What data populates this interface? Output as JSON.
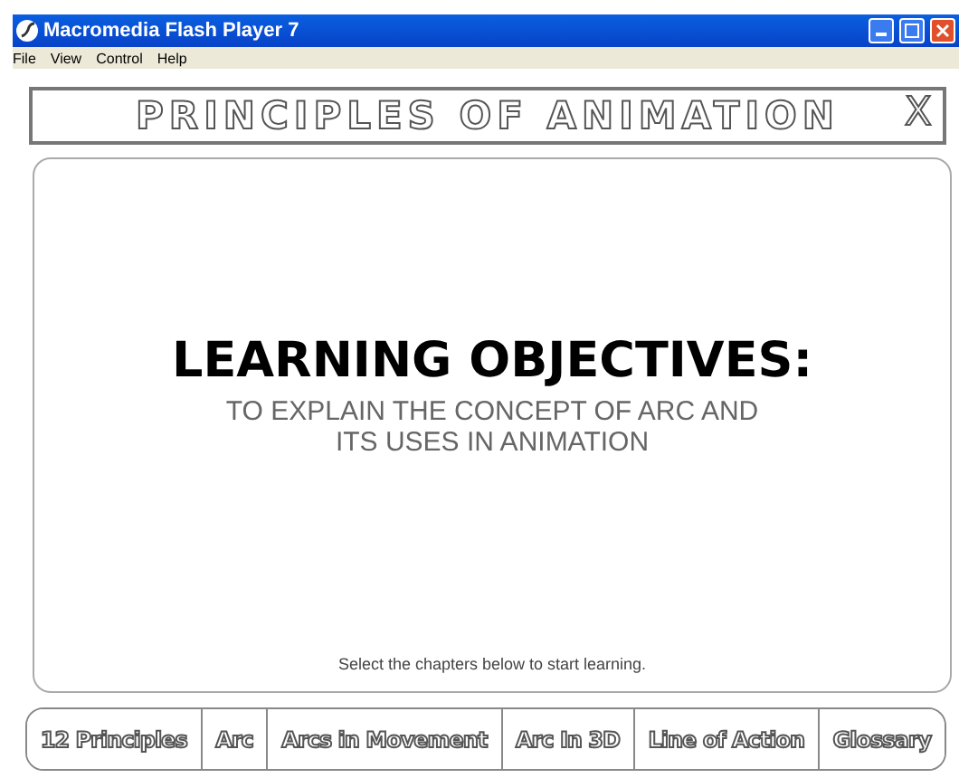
{
  "window": {
    "title": "Macromedia Flash Player 7"
  },
  "menu": [
    "File",
    "View",
    "Control",
    "Help"
  ],
  "header": {
    "title": "PRINCIPLES OF ANIMATION",
    "close": "X"
  },
  "content": {
    "heading": "LEARNING OBJECTIVES:",
    "objective": "TO EXPLAIN THE CONCEPT OF ARC AND ITS USES IN ANIMATION",
    "hint": "Select the chapters below to start learning."
  },
  "chapters": [
    {
      "label": "12 Principles"
    },
    {
      "label": "Arc"
    },
    {
      "label": "Arcs in Movement"
    },
    {
      "label": "Arc In 3D"
    },
    {
      "label": "Line of Action"
    },
    {
      "label": "Glossary"
    }
  ]
}
